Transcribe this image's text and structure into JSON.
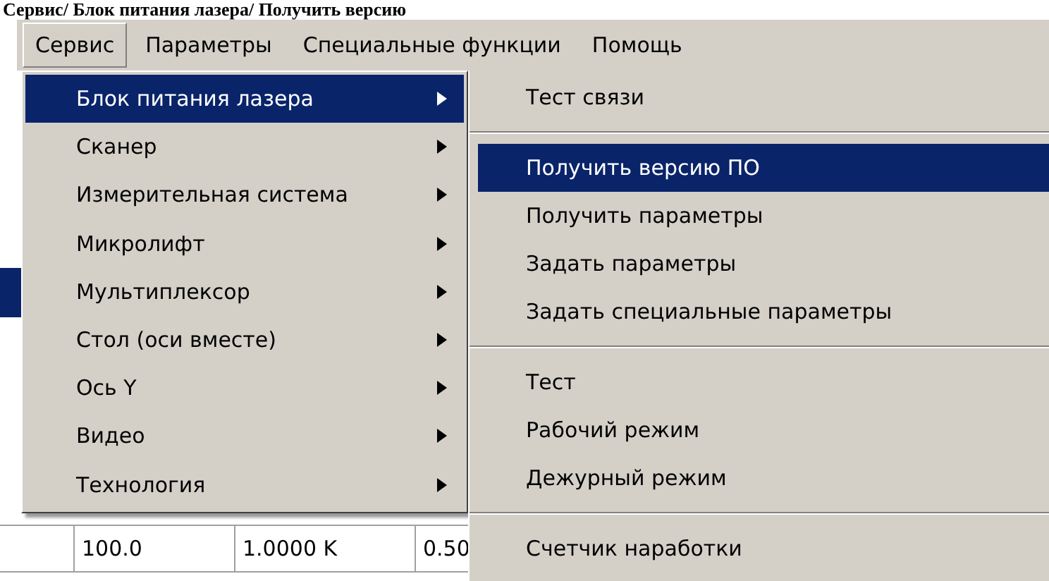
{
  "caption": "Сервис/ Блок питания лазера/ Получить версию",
  "menubar": [
    {
      "label": "Сервис",
      "selected": true
    },
    {
      "label": "Параметры",
      "selected": false
    },
    {
      "label": "Специальные функции",
      "selected": false
    },
    {
      "label": "Помощь",
      "selected": false
    }
  ],
  "submenu": {
    "items": [
      {
        "label": "Блок питания лазера",
        "selected": true
      },
      {
        "label": "Сканер",
        "selected": false
      },
      {
        "label": "Измерительная система",
        "selected": false
      },
      {
        "label": "Микролифт",
        "selected": false
      },
      {
        "label": "Мультиплексор",
        "selected": false
      },
      {
        "label": "Стол (оси вместе)",
        "selected": false
      },
      {
        "label": "Ось Y",
        "selected": false
      },
      {
        "label": "Видео",
        "selected": false
      },
      {
        "label": "Технология",
        "selected": false
      }
    ]
  },
  "submenu_2": {
    "items": [
      {
        "kind": "item",
        "label": "Тест связи",
        "selected": false
      },
      {
        "kind": "separator"
      },
      {
        "kind": "item",
        "label": "Получить версию ПО",
        "selected": true
      },
      {
        "kind": "item",
        "label": "Получить параметры",
        "selected": false
      },
      {
        "kind": "item",
        "label": "Задать параметры",
        "selected": false
      },
      {
        "kind": "item",
        "label": "Задать специальные параметры",
        "selected": false
      },
      {
        "kind": "separator"
      },
      {
        "kind": "item",
        "label": "Тест",
        "selected": false
      },
      {
        "kind": "item",
        "label": "Рабочий режим",
        "selected": false
      },
      {
        "kind": "item",
        "label": "Дежурный режим",
        "selected": false
      },
      {
        "kind": "separator"
      },
      {
        "kind": "item",
        "label": "Счетчик наработки",
        "selected": false
      }
    ]
  },
  "table": {
    "rows": [
      [
        "100.0",
        "1.0000 K",
        "0.50"
      ]
    ]
  }
}
